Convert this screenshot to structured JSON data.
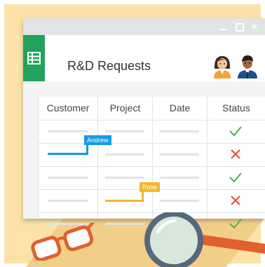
{
  "window": {
    "title": "R&D Requests",
    "controls": [
      "minimize-icon",
      "maximize-icon",
      "close-icon"
    ]
  },
  "app_icon": "sheets-icon",
  "columns": [
    "Customer",
    "Project",
    "Date",
    "Status"
  ],
  "rows": [
    {
      "status": "approved"
    },
    {
      "status": "rejected"
    },
    {
      "status": "approved"
    },
    {
      "status": "rejected"
    },
    {
      "status": "approved"
    }
  ],
  "collaborators": [
    {
      "name": "Andrew",
      "color": "#1a9be0"
    },
    {
      "name": "Rose",
      "color": "#f4b72e"
    }
  ],
  "colors": {
    "background": "#fbe2a9",
    "sheets_green": "#21a35b",
    "check_green": "#4caf50",
    "cross_red": "#e5493a"
  }
}
